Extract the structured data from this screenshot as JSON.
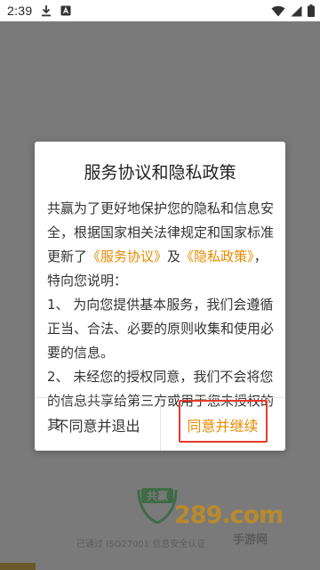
{
  "status_bar": {
    "time": "2:39",
    "icons": [
      "download-icon",
      "text-app-icon",
      "wifi-icon",
      "signal-icon",
      "battery-icon"
    ]
  },
  "dialog": {
    "title": "服务协议和隐私政策",
    "paragraph1_before": "共赢为了更好地保护您的隐私和信息安全，根据国家相关法律规定和国家标准更新了",
    "service_link": "《服务协议》",
    "and_text": "及",
    "privacy_link": "《隐私政策》",
    "paragraph1_after": "，特向您说明：",
    "item1": "1、 为向您提供基本服务，我们会遵循正当、合法、必要的原则收集和使用必要的信息。",
    "item2": "2、 未经您的授权同意，我们不会将您的信息共享给第三方或用于您未授权的其",
    "disagree_button": "不同意并退出",
    "agree_button": "同意并继续"
  },
  "background": {
    "logo_text": "共赢",
    "brand_mark": "289.com",
    "brand_sub": "手游网",
    "cert_text": "已通过 ISO27001 信息安全认证"
  },
  "colors": {
    "accent": "#e58a00",
    "highlight": "#e53a2b",
    "backdrop": "#7a7a7a"
  }
}
